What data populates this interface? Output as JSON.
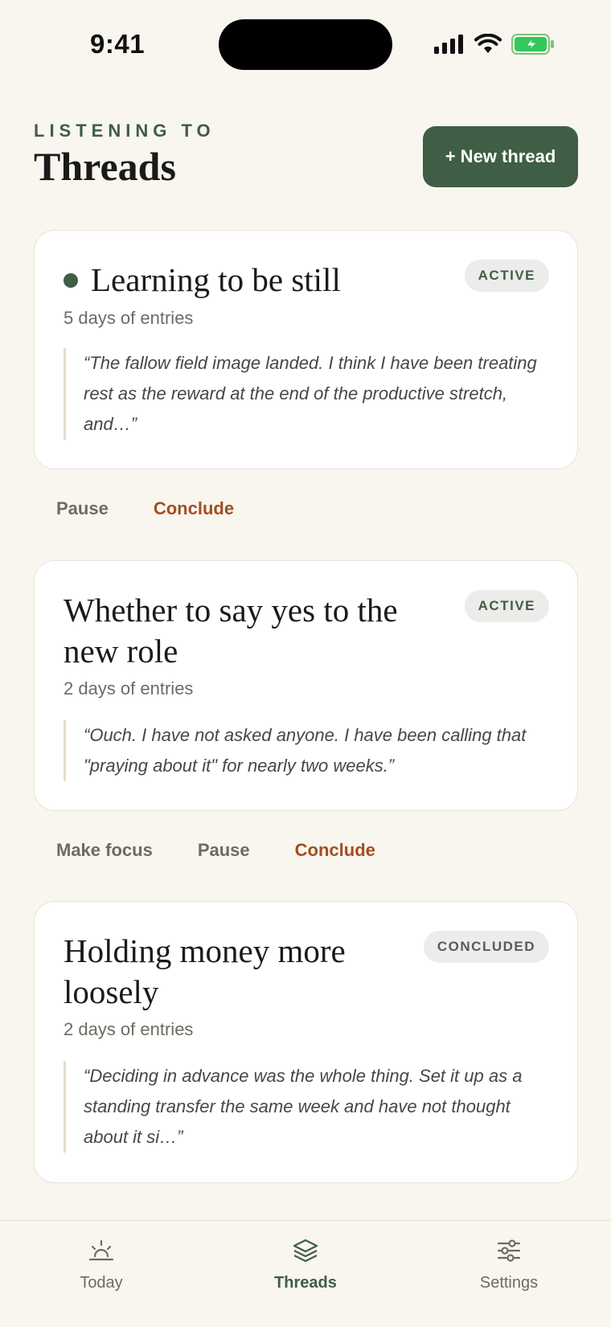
{
  "status_bar": {
    "time": "9:41"
  },
  "header": {
    "kicker": "LISTENING TO",
    "title": "Threads",
    "new_thread_label": "+ New thread"
  },
  "threads": [
    {
      "title": "Learning to be still",
      "status": "ACTIVE",
      "meta": "5 days of entries",
      "quote": "“The fallow field image landed. I think I have been treating rest as the reward at the end of the productive stretch, and…”",
      "actions": [
        "Pause",
        "Conclude"
      ]
    },
    {
      "title": "Whether to say yes to the new role",
      "status": "ACTIVE",
      "meta": "2 days of entries",
      "quote": "“Ouch. I have not asked anyone. I have been calling that \"praying about it\" for nearly two weeks.”",
      "actions": [
        "Make focus",
        "Pause",
        "Conclude"
      ]
    },
    {
      "title": "Holding money more loosely",
      "status": "CONCLUDED",
      "meta": "2 days of entries",
      "quote": "“Deciding in advance was the whole thing. Set it up as a standing transfer the same week and have not thought about it si…”"
    }
  ],
  "tab_bar": {
    "tabs": [
      {
        "label": "Today",
        "icon": "sunrise-icon"
      },
      {
        "label": "Threads",
        "icon": "layers-icon",
        "active": true
      },
      {
        "label": "Settings",
        "icon": "sliders-icon"
      }
    ]
  },
  "colors": {
    "accent": "#3f5e45",
    "conclude": "#a04f21",
    "background": "#f9f5ef"
  }
}
